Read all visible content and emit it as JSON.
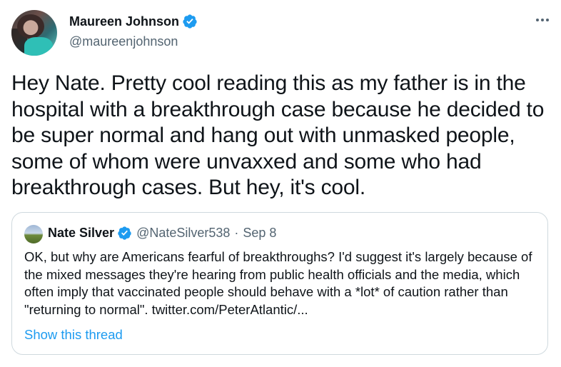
{
  "tweet": {
    "author": {
      "name": "Maureen Johnson",
      "handle": "@maureenjohnson",
      "verified": true
    },
    "text": "Hey Nate. Pretty cool reading this as my father is in the hospital with a breakthrough case because he decided to be super normal and hang out with unmasked people, some of whom were unvaxxed and some who had breakthrough cases. But hey, it's cool.",
    "more_icon": "more-horizontal-icon",
    "colors": {
      "text": "#0f1419",
      "secondary": "#536471",
      "accent": "#1d9bf0",
      "border": "#cfd9de"
    }
  },
  "quoted": {
    "author": {
      "name": "Nate Silver",
      "handle": "@NateSilver538",
      "date_sep": "·",
      "date": "Sep 8",
      "verified": true
    },
    "text": "OK, but why are Americans fearful of breakthroughs? I'd suggest it's largely because of the mixed messages they're hearing from public health officials and the media, which often imply that vaccinated people should behave with a *lot* of caution rather than \"returning to normal\". twitter.com/PeterAtlantic/...",
    "show_thread": "Show this thread"
  }
}
